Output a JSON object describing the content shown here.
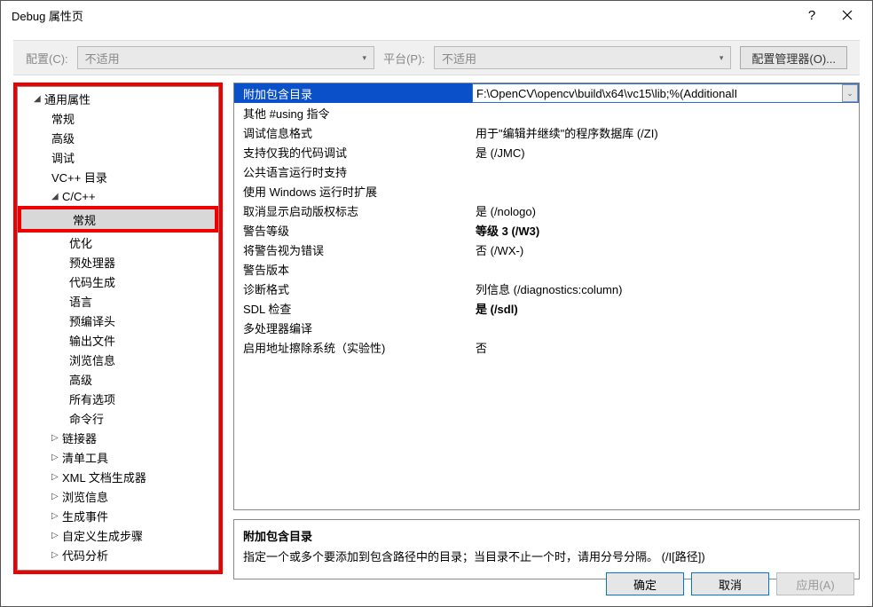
{
  "title": "Debug 属性页",
  "topbar": {
    "config_label": "配置(C):",
    "config_value": "不适用",
    "platform_label": "平台(P):",
    "platform_value": "不适用",
    "manager_btn": "配置管理器(O)..."
  },
  "tree": {
    "root": "通用属性",
    "items_l2": [
      "常规",
      "高级",
      "调试",
      "VC++ 目录"
    ],
    "ccpp": "C/C++",
    "ccpp_items": [
      "常规",
      "优化",
      "预处理器",
      "代码生成",
      "语言",
      "预编译头",
      "输出文件",
      "浏览信息",
      "高级",
      "所有选项",
      "命令行"
    ],
    "rest": [
      "链接器",
      "清单工具",
      "XML 文档生成器",
      "浏览信息",
      "生成事件",
      "自定义生成步骤",
      "代码分析"
    ]
  },
  "grid": [
    {
      "label": "附加包含目录",
      "value": "F:\\OpenCV\\opencv\\build\\x64\\vc15\\lib;%(AdditionalI",
      "sel": true
    },
    {
      "label": "其他 #using 指令",
      "value": ""
    },
    {
      "label": "调试信息格式",
      "value": "用于\"编辑并继续\"的程序数据库 (/ZI)"
    },
    {
      "label": "支持仅我的代码调试",
      "value": "是 (/JMC)"
    },
    {
      "label": "公共语言运行时支持",
      "value": ""
    },
    {
      "label": "使用 Windows 运行时扩展",
      "value": ""
    },
    {
      "label": "取消显示启动版权标志",
      "value": "是 (/nologo)"
    },
    {
      "label": "警告等级",
      "value": "等级 3 (/W3)",
      "bold": true
    },
    {
      "label": "将警告视为错误",
      "value": "否 (/WX-)"
    },
    {
      "label": "警告版本",
      "value": ""
    },
    {
      "label": "诊断格式",
      "value": "列信息 (/diagnostics:column)"
    },
    {
      "label": "SDL 检查",
      "value": "是 (/sdl)",
      "bold": true
    },
    {
      "label": "多处理器编译",
      "value": ""
    },
    {
      "label": "启用地址擦除系统（实验性)",
      "value": "否"
    }
  ],
  "help": {
    "title": "附加包含目录",
    "body": "指定一个或多个要添加到包含路径中的目录；当目录不止一个时，请用分号分隔。     (/I[路径])"
  },
  "buttons": {
    "ok": "确定",
    "cancel": "取消",
    "apply": "应用(A)"
  },
  "watermark": ""
}
